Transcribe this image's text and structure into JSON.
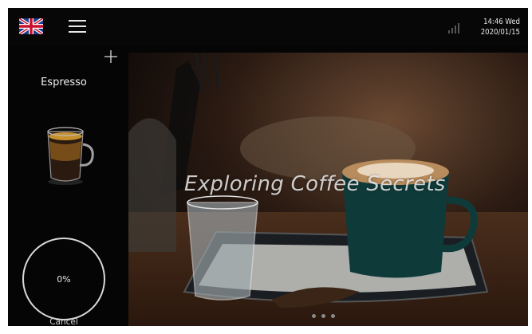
{
  "status_bar": {
    "time_day": "14:46 Wed",
    "date": "2020/01/15"
  },
  "icons": {
    "language": "uk-flag-icon",
    "menu": "hamburger-menu-icon",
    "signal": "signal-strength-icon",
    "add": "plus-icon"
  },
  "drink": {
    "name": "Espresso",
    "progress": "0%",
    "progress_value": 0,
    "cancel_label": "Cancel"
  },
  "banner": {
    "title": "Exploring Coffee Secrets",
    "active_slide": 1,
    "slide_count": 3
  },
  "colors": {
    "background": "#050505",
    "text": "#f0f0f0",
    "ring": "#d8d8d8"
  }
}
